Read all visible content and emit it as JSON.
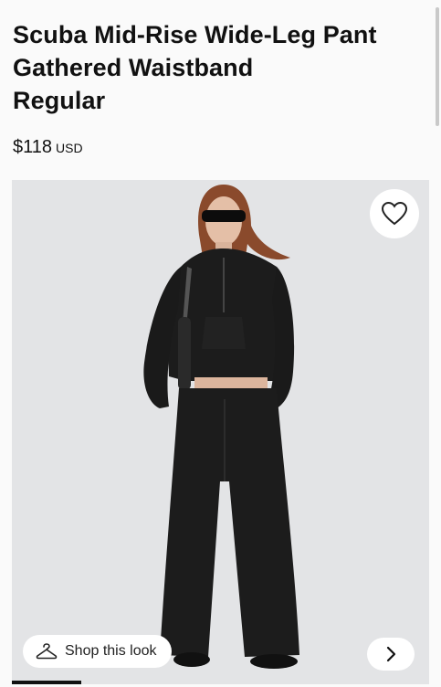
{
  "product": {
    "title_lines": [
      "Scuba Mid-Rise Wide-Leg Pant",
      "Gathered Waistband",
      "Regular"
    ],
    "price": "$118",
    "currency": "USD"
  },
  "gallery": {
    "shop_look_label": "Shop this look",
    "wishlist_icon": "heart-outline-icon",
    "next_icon": "chevron-right-icon",
    "shop_icon": "hanger-icon",
    "background_color": "#e3e4e6",
    "garment_color": "#1c1c1c"
  }
}
